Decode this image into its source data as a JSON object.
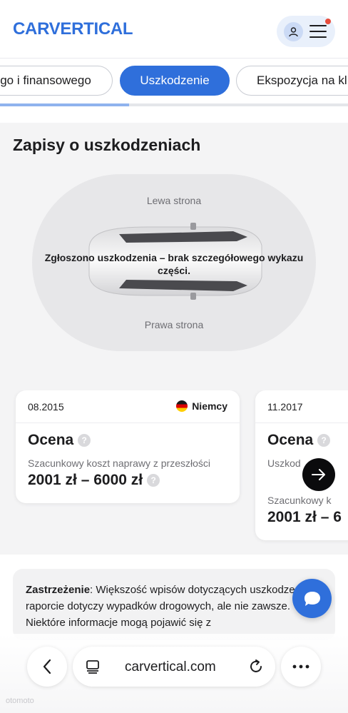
{
  "header": {
    "logo_text": "CARVERTICAL",
    "user_icon": "user-icon",
    "menu_icon": "hamburger-menu-icon",
    "accent_color": "#2f6fdb"
  },
  "tabs": [
    {
      "label": "go i finansowego",
      "active": false
    },
    {
      "label": "Uszkodzenie",
      "active": true
    },
    {
      "label": "Ekspozycja na kl",
      "active": false
    }
  ],
  "progress": 0.37,
  "damage_section": {
    "title": "Zapisy o uszkodzeniach",
    "left_side_label": "Lewa strona",
    "right_side_label": "Prawa strona",
    "message": "Zgłoszono uszkodzenia – brak szczegółowego wykazu części."
  },
  "cards": [
    {
      "date": "08.2015",
      "country": "Niemcy",
      "score_label": "Ocena",
      "cost_label": "Szacunkowy koszt naprawy z przeszłości",
      "cost_value": "2001 zł – 6000 zł"
    },
    {
      "date": "11.2017",
      "score_label": "Ocena",
      "partial_label": "Uszkod",
      "cost_label": "Szacunkowy k",
      "cost_value": "2001 zł – 6"
    }
  ],
  "next_icon": "arrow-right-icon",
  "disclaimer": {
    "label": "Zastrzeżenie",
    "text": ": Większość wpisów dotyczących uszkodzeń w raporcie dotyczy wypadków drogowych, ale nie zawsze. Niektóre informacje mogą pojawić się z"
  },
  "chat_icon": "chat-bubble-icon",
  "browser": {
    "url": "carvertical.com",
    "back_icon": "chevron-left-icon",
    "tabs_icon": "tabs-icon",
    "reload_icon": "reload-icon",
    "more_icon": "more-dots-icon"
  },
  "watermark": "otomoto"
}
